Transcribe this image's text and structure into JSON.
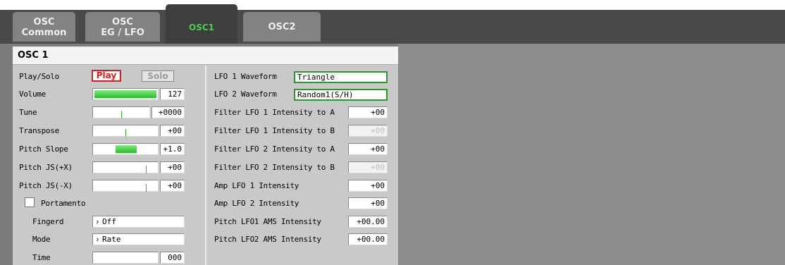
{
  "tabs": [
    {
      "line1": "OSC",
      "line2": "Common"
    },
    {
      "line1": "OSC",
      "line2": "EG / LFO"
    },
    {
      "line1": "OSC1",
      "line2": ""
    },
    {
      "line1": "OSC2",
      "line2": ""
    }
  ],
  "panel": {
    "title": "OSC 1",
    "left": {
      "play_solo": {
        "label": "Play/Solo",
        "play": "Play",
        "solo": "Solo"
      },
      "volume": {
        "label": "Volume",
        "value": "127",
        "level": 1.0
      },
      "tune": {
        "label": "Tune",
        "value": "+0000"
      },
      "transpose": {
        "label": "Transpose",
        "value": "+00"
      },
      "pitch_slope": {
        "label": "Pitch Slope",
        "value": "+1.0"
      },
      "pitch_js_px": {
        "label": "Pitch JS(+X)",
        "value": "+00"
      },
      "pitch_js_mx": {
        "label": "Pitch JS(-X)",
        "value": "+00"
      },
      "portamento": {
        "label": "Portamento",
        "checked": false
      },
      "fingerd": {
        "label": "Fingerd",
        "value": "Off"
      },
      "mode": {
        "label": "Mode",
        "value": "Rate"
      },
      "time": {
        "label": "Time",
        "value": "000"
      }
    },
    "right": {
      "lfo1_wave": {
        "label": "LFO 1 Waveform",
        "value": "Triangle"
      },
      "lfo2_wave": {
        "label": "LFO 2 Waveform",
        "value": "Random1(S/H)"
      },
      "f_lfo1_a": {
        "label": "Filter LFO 1 Intensity to A",
        "value": "+00"
      },
      "f_lfo1_b": {
        "label": "Filter LFO 1 Intensity to B",
        "value": "+00"
      },
      "f_lfo2_a": {
        "label": "Filter LFO 2 Intensity to A",
        "value": "+00"
      },
      "f_lfo2_b": {
        "label": "Filter LFO 2 Intensity to B",
        "value": "+00"
      },
      "amp_lfo1": {
        "label": "Amp LFO 1 Intensity",
        "value": "+00"
      },
      "amp_lfo2": {
        "label": "Amp LFO 2 Intensity",
        "value": "+00"
      },
      "p_lfo1_ams": {
        "label": "Pitch LFO1 AMS Intensity",
        "value": "+00.00"
      },
      "p_lfo2_ams": {
        "label": "Pitch LFO2 AMS Intensity",
        "value": "+00.00"
      }
    }
  },
  "colors": {
    "active_tab_text": "#4cd04c",
    "play_red": "#d42020",
    "slider_green": "#2eb82e"
  },
  "icons": {
    "dropdown": "chevron-right-icon"
  }
}
